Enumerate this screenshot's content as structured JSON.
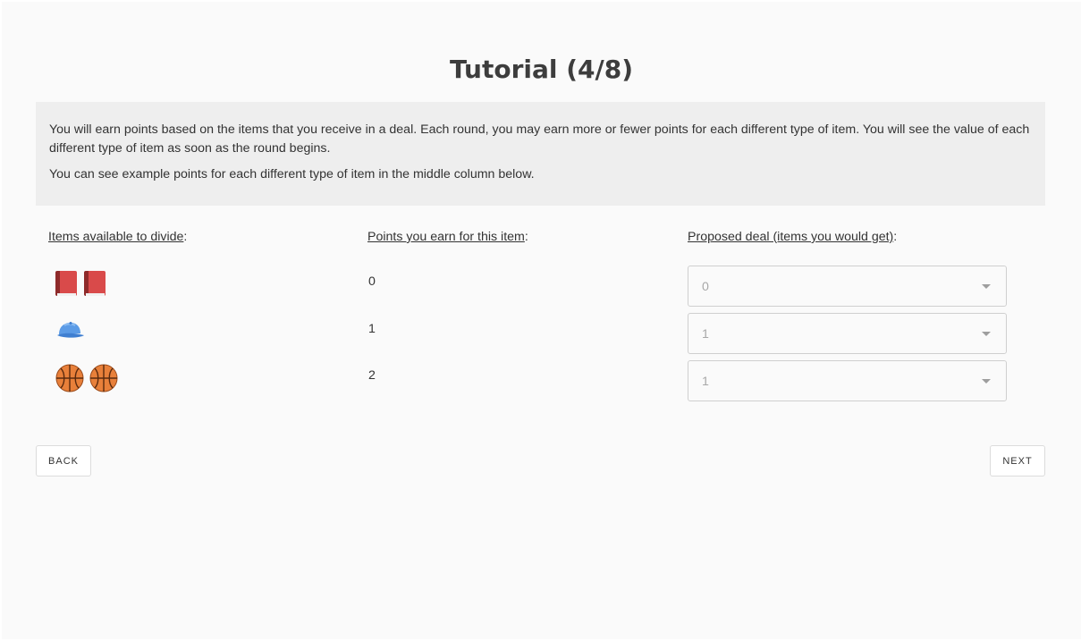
{
  "title": "Tutorial (4/8)",
  "info": {
    "paragraph1": "You will earn points based on the items that you receive in a deal. Each round, you may earn more or fewer points for each different type of item. You will see the value of each different type of item as soon as the round begins.",
    "paragraph2": "You can see example points for each different type of item in the middle column below."
  },
  "columns": {
    "items": "Items available to divide",
    "points": "Points you earn for this item",
    "deal": "Proposed deal (items you would get)",
    "colon": ":"
  },
  "rows": [
    {
      "icon": "book-icon",
      "count": 2,
      "points": "0",
      "deal": "0"
    },
    {
      "icon": "cap-icon",
      "count": 1,
      "points": "1",
      "deal": "1"
    },
    {
      "icon": "basketball-icon",
      "count": 2,
      "points": "2",
      "deal": "1"
    }
  ],
  "buttons": {
    "back": "BACK",
    "next": "NEXT"
  },
  "colors": {
    "background": "#fafafa",
    "info_box": "#eeeeee",
    "text": "#333333",
    "select_text": "#a8a8a8"
  }
}
